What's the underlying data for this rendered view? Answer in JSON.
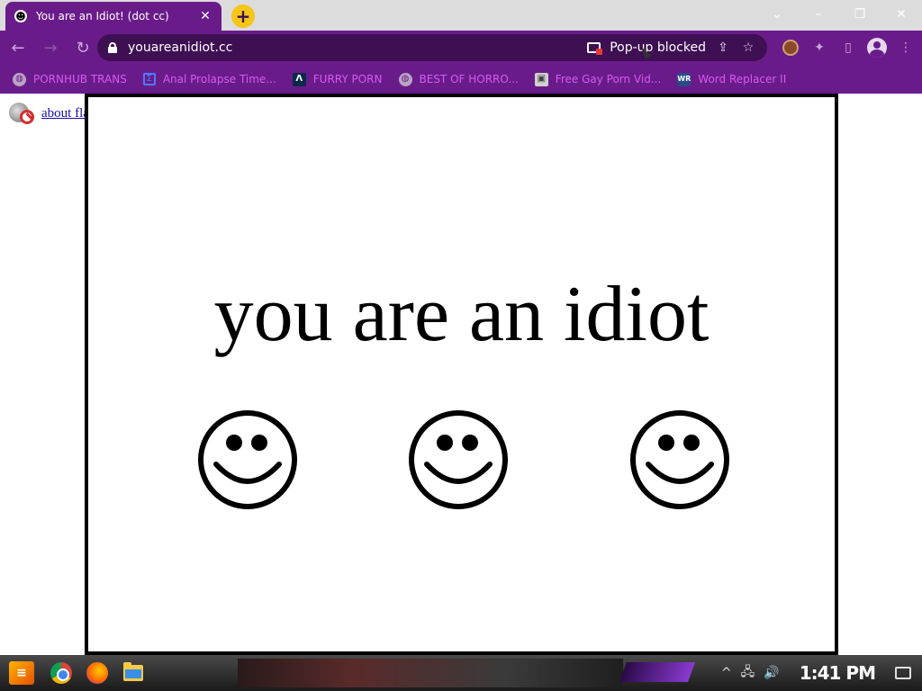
{
  "tab": {
    "title": "You are an Idiot! (dot cc)",
    "favicon": "smiley-icon",
    "close_glyph": "✕",
    "new_tab_glyph": "+"
  },
  "window": {
    "minimize": "–",
    "restore": "❐",
    "close": "✕",
    "dropdown": "⌄"
  },
  "toolbar": {
    "back": "←",
    "forward": "→",
    "reload": "↻",
    "url": "youareanidiot.cc",
    "popup_blocked": "Pop-up blocked",
    "share_glyph": "⇪",
    "star_glyph": "☆",
    "extensions_glyph": "✦",
    "sidepanel_glyph": "▯",
    "menu_glyph": "⋮"
  },
  "bookmarks": [
    {
      "label": "PORNHUB TRANS",
      "icon": "globe-icon",
      "glyph": "🌐"
    },
    {
      "label": "Anal Prolapse Time...",
      "icon": "sigma-icon",
      "glyph": "Σ"
    },
    {
      "label": "FURRY PORN",
      "icon": "lambda-icon",
      "glyph": "Λ"
    },
    {
      "label": "BEST OF HORRO...",
      "icon": "globe-icon",
      "glyph": "🌐"
    },
    {
      "label": "Free Gay Porn Vid...",
      "icon": "cube-icon",
      "glyph": "▣"
    },
    {
      "label": "Word Replacer II",
      "icon": "wr-icon",
      "glyph": "WR"
    }
  ],
  "page": {
    "flash_link": "about flash",
    "headline": "you are an idiot",
    "smiley_count": 3
  },
  "taskbar": {
    "start_glyph": "≡",
    "clock": "1:41 PM",
    "tray_up": "^",
    "tray_network": "🖧",
    "tray_volume": "🔊"
  },
  "colors": {
    "chrome_purple": "#6a1b8a",
    "omnibox_bg": "#3e0f52",
    "bookmark_text": "#d45cf0",
    "new_tab_yellow": "#f5c518"
  }
}
